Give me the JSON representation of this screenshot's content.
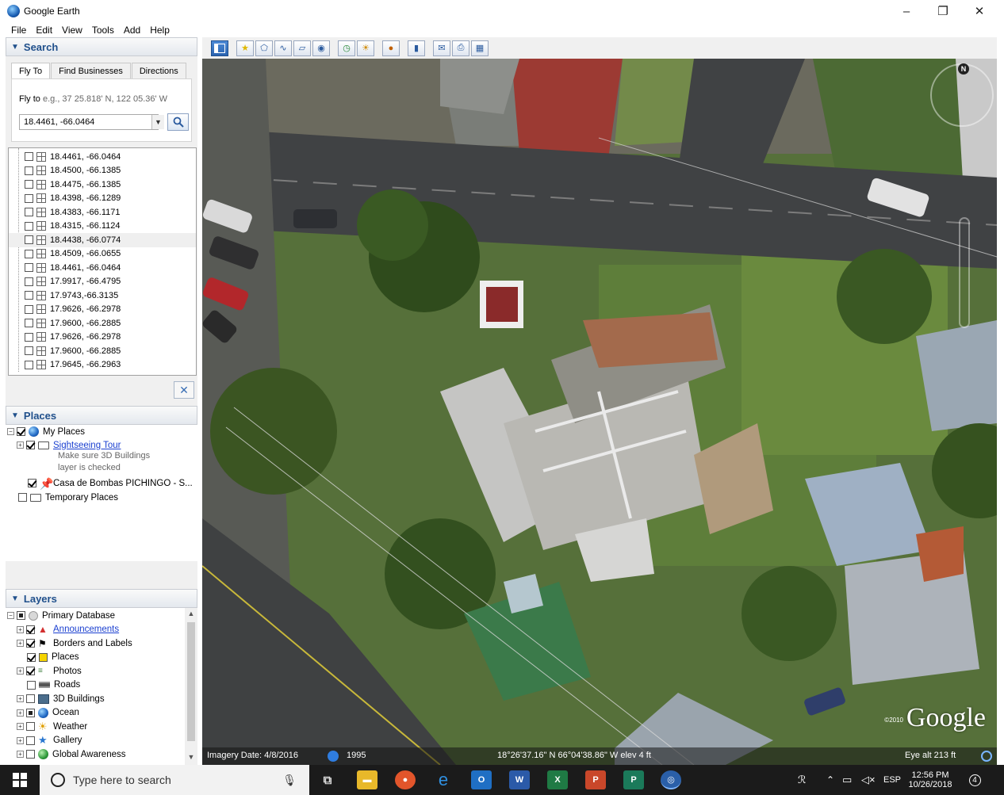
{
  "window": {
    "title": "Google Earth",
    "controls": {
      "minimize": "–",
      "restore": "❐",
      "close": "✕"
    }
  },
  "menu": [
    "File",
    "Edit",
    "View",
    "Tools",
    "Add",
    "Help"
  ],
  "search": {
    "header": "Search",
    "tabs": [
      "Fly To",
      "Find Businesses",
      "Directions"
    ],
    "fly_to_label": "Fly to",
    "fly_to_example": "e.g., 37 25.818' N, 122 05.36' W",
    "input_value": "18.4461,  -66.0464",
    "results": [
      "18.4461, -66.0464",
      "18.4500, -66.1385",
      "18.4475, -66.1385",
      "18.4398, -66.1289",
      "18.4383, -66.1171",
      "18.4315, -66.1124",
      "18.4438, -66.0774",
      "18.4509, -66.0655",
      "18.4461, -66.0464",
      "17.9917, -66.4795",
      "17.9743,-66.3135",
      "17.9626, -66.2978",
      "17.9600, -66.2885",
      "17.9626, -66.2978",
      "17.9600, -66.2885",
      "17.9645, -66.2963"
    ],
    "selected_result": 6,
    "clear_label": "✕"
  },
  "places": {
    "header": "Places",
    "my_places": "My Places",
    "sightseeing": "Sightseeing Tour",
    "sightseeing_note_1": "Make sure 3D Buildings",
    "sightseeing_note_2": "layer is checked",
    "placemark": "Casa de Bombas PICHINGO - S...",
    "temporary": "Temporary Places"
  },
  "layers": {
    "header": "Layers",
    "primary": "Primary Database",
    "items": [
      "Announcements",
      "Borders and Labels",
      "Places",
      "Photos",
      "Roads",
      "3D Buildings",
      "Ocean",
      "Weather",
      "Gallery",
      "Global Awareness"
    ]
  },
  "map": {
    "imagery_date": "Imagery Date: 4/8/2016",
    "historical_year": "1995",
    "coords": "18°26'37.16\" N  66°04'38.86\" W  elev    4 ft",
    "eye_alt": "Eye alt    213 ft",
    "logo": "Google",
    "copyright": "©2010",
    "compass_n": "N"
  },
  "taskbar": {
    "search_placeholder": "Type here to search",
    "time": "12:56 PM",
    "date": "10/26/2018",
    "lang": "ESP",
    "notifications": "4"
  },
  "colors": {
    "panel_header_text": "#1f4f8b",
    "link": "#1a3fd0",
    "grass": "#4e6b37",
    "road": "#3f4142",
    "taskbar": "#1b1b1b"
  }
}
